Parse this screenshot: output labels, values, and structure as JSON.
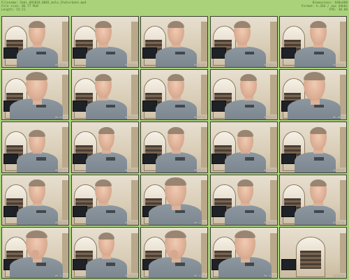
{
  "header": {
    "filename": "Filename: Zobi_892018_0001_male_Chaturbate.mp4",
    "filesize": "File size: 86.77 MiB",
    "length": "Length: 15:21",
    "dimensions": "Dimensions: 640x480",
    "format": "Format: h.264 / aac 44kHz",
    "fps": "FPS: 30.00"
  },
  "frames": [
    {
      "ts": "00:00:36",
      "pose": "center"
    },
    {
      "ts": "00:01:13",
      "pose": "left"
    },
    {
      "ts": "00:01:50",
      "pose": "center"
    },
    {
      "ts": "00:02:27",
      "pose": "left"
    },
    {
      "ts": "00:03:04",
      "pose": "right"
    },
    {
      "ts": "00:03:41",
      "pose": "close"
    },
    {
      "ts": "00:04:18",
      "pose": "left"
    },
    {
      "ts": "00:04:55",
      "pose": "center"
    },
    {
      "ts": "00:05:32",
      "pose": "right"
    },
    {
      "ts": "00:06:09",
      "pose": "close"
    },
    {
      "ts": "00:06:46",
      "pose": "low"
    },
    {
      "ts": "00:07:23",
      "pose": "center"
    },
    {
      "ts": "00:08:00",
      "pose": "center"
    },
    {
      "ts": "00:08:37",
      "pose": "low"
    },
    {
      "ts": "00:09:14",
      "pose": "right"
    },
    {
      "ts": "00:09:51",
      "pose": "center"
    },
    {
      "ts": "00:10:28",
      "pose": "left"
    },
    {
      "ts": "00:11:05",
      "pose": "close"
    },
    {
      "ts": "00:11:42",
      "pose": "center"
    },
    {
      "ts": "00:12:19",
      "pose": "right"
    },
    {
      "ts": "00:12:56",
      "pose": "close"
    },
    {
      "ts": "00:13:33",
      "pose": "center"
    },
    {
      "ts": "00:14:10",
      "pose": "close"
    },
    {
      "ts": "00:14:47",
      "pose": "close"
    },
    {
      "ts": "00:15:20",
      "pose": "empty"
    }
  ],
  "colors": {
    "sheet_background": "#a9d27a",
    "header_text": "#4b6b2d",
    "thumb_border": "#3c3f33",
    "shirt": "#8d97a0",
    "skin": "#dcae94"
  }
}
